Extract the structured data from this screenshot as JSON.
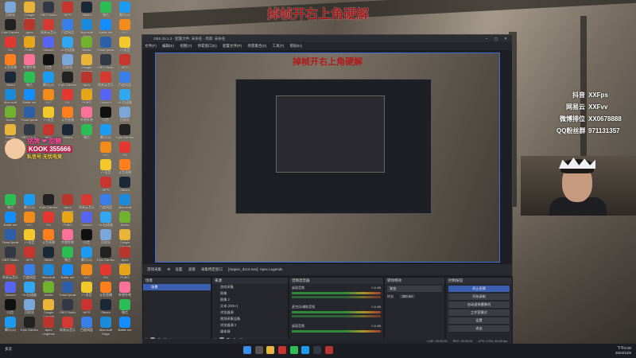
{
  "overlay_title": "掉帧开右上角硬解",
  "preview_title": "掉帧开右上角硬解",
  "desktop_icons": [
    {
      "label": "回收站",
      "color": "#7aa7d8"
    },
    {
      "label": "Google Chrome",
      "color": "#e8b53a"
    },
    {
      "label": "OBS Studio",
      "color": "#333944"
    },
    {
      "label": "WPS",
      "color": "#c7352f"
    },
    {
      "label": "Steam",
      "color": "#1b2838"
    },
    {
      "label": "微信",
      "color": "#2dbd55"
    },
    {
      "label": "腾讯QQ",
      "color": "#1d9bf0"
    },
    {
      "label": "Epic Games",
      "color": "#222"
    },
    {
      "label": "Apex Legends",
      "color": "#b8372c"
    },
    {
      "label": "网易云音乐",
      "color": "#d33a31"
    },
    {
      "label": "百度网盘",
      "color": "#3a7ee8"
    },
    {
      "label": "Microsoft Edge",
      "color": "#1c8ad8"
    },
    {
      "label": "Battle.net",
      "color": "#148eff"
    },
    {
      "label": "VLC",
      "color": "#f18c1c"
    },
    {
      "label": "EA",
      "color": "#e2382f"
    },
    {
      "label": "PUBG",
      "color": "#e7a61a"
    },
    {
      "label": "Discord",
      "color": "#5865f2"
    },
    {
      "label": "UU加速器",
      "color": "#32a7f0"
    },
    {
      "label": "Nvidia",
      "color": "#6fb22d"
    },
    {
      "label": "TeamSpeak",
      "color": "#2d5fa8"
    },
    {
      "label": "YY语音",
      "color": "#f3c82b"
    },
    {
      "label": "斗鱼直播",
      "color": "#ff7f1e"
    },
    {
      "label": "哔哩哔哩",
      "color": "#fb7299"
    },
    {
      "label": "抖音",
      "color": "#111"
    }
  ],
  "badge": {
    "line1": "铭牌 ❤ 甜糖",
    "line2": "KOOK 355666",
    "line3": "私信号:无忧电竞"
  },
  "obs": {
    "window_title": "OBS 29.1.3 - 配置文件: 未命名 - 场景: 未命名",
    "menu": [
      "文件(F)",
      "编辑(E)",
      "视图(V)",
      "停靠窗口(D)",
      "配置文件(P)",
      "场景集合(S)",
      "工具(T)",
      "帮助(H)"
    ],
    "toolbar": {
      "source_name": "游戏采集",
      "settings": "设置",
      "filter": "滤镜",
      "mode": "采集特定窗口",
      "window": "[r5apex_dx12.exe]: Apex Legends"
    },
    "docks": {
      "scenes": {
        "title": "场景",
        "items": [
          "场景"
        ]
      },
      "sources": {
        "title": "来源",
        "items": [
          "游戏采集",
          "图像",
          "图像 2",
          "文本 (GDI+)",
          "浏览器源",
          "视频采集设备",
          "浏览器源 2",
          "媒体源",
          "音频输入采集",
          "浏览器源 3"
        ]
      },
      "mixer": {
        "title": "音频混音器",
        "tracks": [
          {
            "name": "桌面音频",
            "db": "0.0 dB"
          },
          {
            "name": "麦克风/辅助音频",
            "db": "0.0 dB"
          },
          {
            "name": "桌面音频",
            "db": "0.0 dB"
          }
        ]
      },
      "transitions": {
        "title": "转场特效",
        "type": "渐变",
        "duration_label": "时长",
        "duration": "300 ms"
      },
      "controls": {
        "title": "控制按钮",
        "buttons": [
          "停止直播",
          "开始录制",
          "启动虚拟摄像机",
          "工作室模式",
          "设置",
          "退出"
        ]
      }
    },
    "status": {
      "live": "LIVE: 00:00:00",
      "rec": "REC: 00:00:00",
      "cpu": "CPU: 0.0%, 60.00 fps"
    }
  },
  "overlay_stats": [
    {
      "key": "抖音",
      "value": "XXFps"
    },
    {
      "key": "网易云",
      "value": "XXFvv"
    },
    {
      "key": "微博排位",
      "value": "XX0678888"
    },
    {
      "key": "QQ粉丝群",
      "value": "971131357"
    }
  ],
  "taskbar": {
    "weather": "多云",
    "time": "下午6:30",
    "date": "2024/12/6"
  }
}
